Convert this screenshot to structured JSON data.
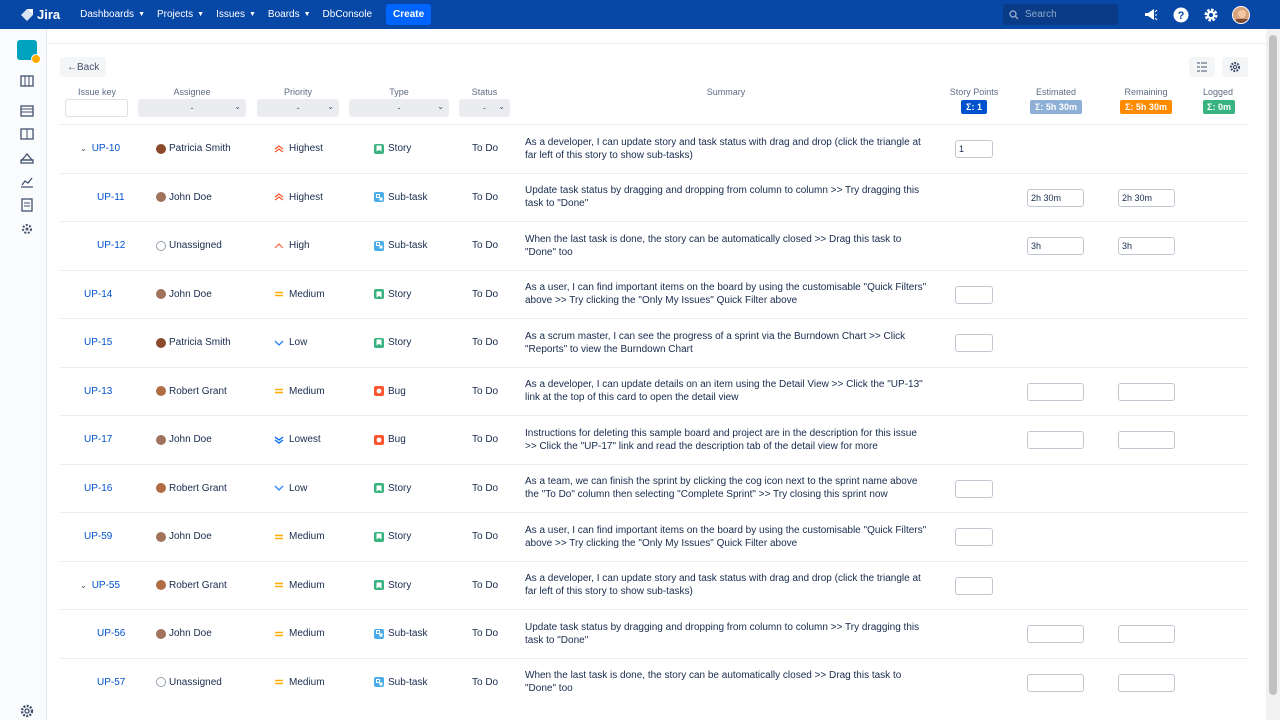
{
  "nav": {
    "brand": "Jira",
    "links": [
      "Dashboards",
      "Projects",
      "Issues",
      "Boards"
    ],
    "dbconsole": "DbConsole",
    "create": "Create",
    "search_placeholder": "Search"
  },
  "toolbar": {
    "back": "Back"
  },
  "columns": {
    "issue_key": "Issue key",
    "assignee": "Assignee",
    "priority": "Priority",
    "type": "Type",
    "status": "Status",
    "summary": "Summary",
    "story_points": "Story Points",
    "estimated": "Estimated",
    "remaining": "Remaining",
    "logged": "Logged"
  },
  "filters": {
    "assignee": "-",
    "priority": "-",
    "type": "-",
    "status": "-"
  },
  "sums": {
    "story_points": "Σ: 1",
    "estimated": "Σ: 5h 30m",
    "remaining": "Σ: 5h 30m",
    "logged": "Σ: 0m"
  },
  "colors": {
    "nav": "#0747a6",
    "story": "#36b37e",
    "subtask": "#4bade8",
    "bug": "#ff5630",
    "estimated": "#8eb0d6",
    "remaining": "#ff8b00",
    "logged": "#36b37e"
  },
  "rows": [
    {
      "key": "UP-10",
      "expand": "⌄",
      "assignee": "Patricia Smith",
      "priority": "Highest",
      "type": "Story",
      "status": "To Do",
      "summary": "As a developer, I can update story and task status with drag and drop (click the triangle at far left of this story to show sub-tasks)",
      "story_points": "1"
    },
    {
      "key": "UP-11",
      "assignee": "John Doe",
      "priority": "Highest",
      "type": "Sub-task",
      "status": "To Do",
      "summary": "Update task status by dragging and dropping from column to column >> Try dragging this task to \"Done\"",
      "estimated": "2h 30m",
      "remaining": "2h 30m"
    },
    {
      "key": "UP-12",
      "assignee": "Unassigned",
      "priority": "High",
      "type": "Sub-task",
      "status": "To Do",
      "summary": "When the last task is done, the story can be automatically closed >> Drag this task to \"Done\" too",
      "estimated": "3h",
      "remaining": "3h"
    },
    {
      "key": "UP-14",
      "assignee": "John Doe",
      "priority": "Medium",
      "type": "Story",
      "status": "To Do",
      "summary": "As a user, I can find important items on the board by using the customisable \"Quick Filters\" above >> Try clicking the \"Only My Issues\" Quick Filter above",
      "story_points": ""
    },
    {
      "key": "UP-15",
      "assignee": "Patricia Smith",
      "priority": "Low",
      "type": "Story",
      "status": "To Do",
      "summary": "As a scrum master, I can see the progress of a sprint via the Burndown Chart >> Click \"Reports\" to view the Burndown Chart",
      "story_points": ""
    },
    {
      "key": "UP-13",
      "assignee": "Robert Grant",
      "priority": "Medium",
      "type": "Bug",
      "status": "To Do",
      "summary": "As a developer, I can update details on an item using the Detail View >> Click the \"UP-13\" link at the top of this card to open the detail view",
      "estimated": "",
      "remaining": ""
    },
    {
      "key": "UP-17",
      "assignee": "John Doe",
      "priority": "Lowest",
      "type": "Bug",
      "status": "To Do",
      "summary": "Instructions for deleting this sample board and project are in the description for this issue >> Click the \"UP-17\" link and read the description tab of the detail view for more",
      "estimated": "",
      "remaining": ""
    },
    {
      "key": "UP-16",
      "assignee": "Robert Grant",
      "priority": "Low",
      "type": "Story",
      "status": "To Do",
      "summary": "As a team, we can finish the sprint by clicking the cog icon next to the sprint name above the \"To Do\" column then selecting \"Complete Sprint\" >> Try closing this sprint now",
      "story_points": ""
    },
    {
      "key": "UP-59",
      "assignee": "John Doe",
      "priority": "Medium",
      "type": "Story",
      "status": "To Do",
      "summary": "As a user, I can find important items on the board by using the customisable \"Quick Filters\" above >> Try clicking the \"Only My Issues\" Quick Filter above",
      "story_points": ""
    },
    {
      "key": "UP-55",
      "expand": "⌄",
      "assignee": "Robert Grant",
      "priority": "Medium",
      "type": "Story",
      "status": "To Do",
      "summary": "As a developer, I can update story and task status with drag and drop (click the triangle at far left of this story to show sub-tasks)",
      "story_points": ""
    },
    {
      "key": "UP-56",
      "assignee": "John Doe",
      "priority": "Medium",
      "type": "Sub-task",
      "status": "To Do",
      "summary": "Update task status by dragging and dropping from column to column >> Try dragging this task to \"Done\"",
      "estimated": "",
      "remaining": ""
    },
    {
      "key": "UP-57",
      "assignee": "Unassigned",
      "priority": "Medium",
      "type": "Sub-task",
      "status": "To Do",
      "summary": "When the last task is done, the story can be automatically closed >> Drag this task to \"Done\" too",
      "estimated": "",
      "remaining": ""
    }
  ]
}
